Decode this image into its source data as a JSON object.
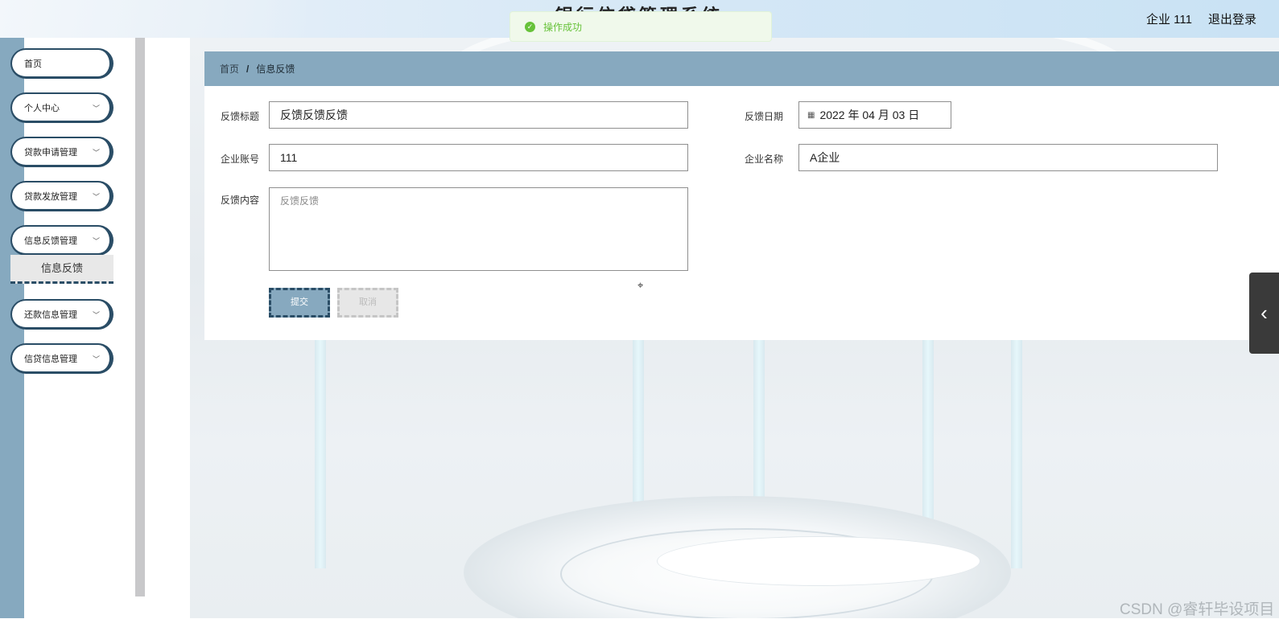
{
  "header": {
    "system_title": "银行信贷管理系统",
    "user": "企业 111",
    "logout": "退出登录"
  },
  "toast": {
    "icon": "check-circle-icon",
    "message": "操作成功",
    "color": "#67c23a"
  },
  "sidebar": {
    "items": [
      {
        "label": "首页"
      },
      {
        "label": "个人中心"
      },
      {
        "label": "贷款申请管理"
      },
      {
        "label": "贷款发放管理"
      },
      {
        "label": "信息反馈管理"
      },
      {
        "label": "还款信息管理"
      },
      {
        "label": "信贷信息管理"
      }
    ],
    "active_submenu": "信息反馈"
  },
  "breadcrumb": {
    "home": "首页",
    "separator": "/",
    "current": "信息反馈"
  },
  "form": {
    "title_label": "反馈标题",
    "title_value": "反馈反馈反馈",
    "date_label": "反馈日期",
    "date_value": "2022 年 04 月 03 日",
    "account_label": "企业账号",
    "account_value": "111",
    "name_label": "企业名称",
    "name_value": "A企业",
    "content_label": "反馈内容",
    "content_value": "反馈反馈",
    "submit_label": "提交",
    "cancel_label": "取消"
  },
  "colors": {
    "accent": "#87a9bf",
    "dark_border": "#2a4d66"
  },
  "watermark": "CSDN @睿轩毕设项目"
}
